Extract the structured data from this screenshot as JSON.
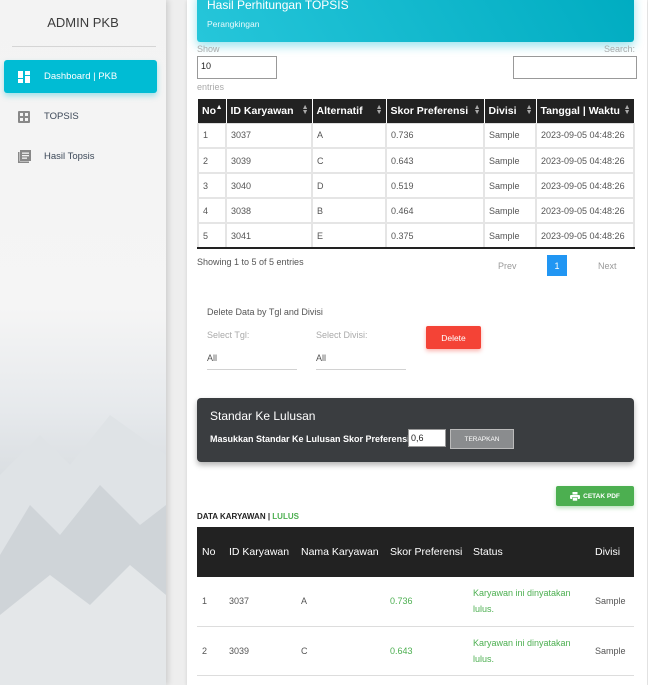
{
  "sidebar": {
    "brand": "ADMIN PKB",
    "items": [
      {
        "label": "Dashboard | PKB",
        "icon": "dashboard-icon",
        "active": true
      },
      {
        "label": "TOPSIS",
        "icon": "grid-icon",
        "active": false
      },
      {
        "label": "Hasil Topsis",
        "icon": "list-icon",
        "active": false
      }
    ]
  },
  "header": {
    "title": "Hasil Perhitungan TOPSIS",
    "subtitle": "Perangkingan"
  },
  "length": {
    "show": "Show",
    "value": "10",
    "entries": "entries"
  },
  "search": {
    "label": "Search:",
    "value": ""
  },
  "ranking_table": {
    "columns": [
      "No",
      "ID Karyawan",
      "Alternatif",
      "Skor Preferensi",
      "Divisi",
      "Tanggal | Waktu"
    ],
    "rows": [
      [
        "1",
        "3037",
        "A",
        "0.736",
        "Sample",
        "2023-09-05 04:48:26"
      ],
      [
        "2",
        "3039",
        "C",
        "0.643",
        "Sample",
        "2023-09-05 04:48:26"
      ],
      [
        "3",
        "3040",
        "D",
        "0.519",
        "Sample",
        "2023-09-05 04:48:26"
      ],
      [
        "4",
        "3038",
        "B",
        "0.464",
        "Sample",
        "2023-09-05 04:48:26"
      ],
      [
        "5",
        "3041",
        "E",
        "0.375",
        "Sample",
        "2023-09-05 04:48:26"
      ]
    ]
  },
  "pagination": {
    "info": "Showing 1 to 5 of 5 entries",
    "prev": "Prev",
    "current": "1",
    "next": "Next"
  },
  "delete_form": {
    "title": "Delete Data by Tgl and Divisi",
    "tgl_label": "Select Tgl:",
    "tgl_value": "All",
    "divisi_label": "Select Divisi:",
    "divisi_value": "All",
    "button": "Delete"
  },
  "standard": {
    "title": "Standar Ke Lulusan",
    "label": "Masukkan Standar Ke Lulusan Skor Preferensi:",
    "value": "0,6",
    "button": "TERAPKAN"
  },
  "pdf_button": "CETAK PDF",
  "section": {
    "prefix": "DATA KARYAWAN",
    "sep": " | ",
    "status": "LULUS"
  },
  "pass_table": {
    "columns": [
      "No",
      "ID Karyawan",
      "Nama Karyawan",
      "Skor Preferensi",
      "Status",
      "Divisi"
    ],
    "rows": [
      [
        "1",
        "3037",
        "A",
        "0.736",
        "Karyawan ini dinyatakan lulus.",
        "Sample"
      ],
      [
        "2",
        "3039",
        "C",
        "0.643",
        "Karyawan ini dinyatakan lulus.",
        "Sample"
      ]
    ]
  },
  "colors": {
    "accent": "#00bcd4",
    "danger": "#f44336",
    "success": "#4caf50",
    "dark": "#222222"
  }
}
